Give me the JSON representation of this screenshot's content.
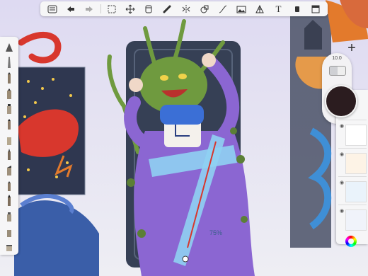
{
  "toolbar": {
    "icons": [
      "menu-icon",
      "undo-icon",
      "redo-icon",
      "selection-icon",
      "transform-icon",
      "layer-icon",
      "eraser-icon",
      "symmetry-icon",
      "shape-icon",
      "curve-icon",
      "image-icon",
      "perspective-icon",
      "text-icon",
      "fill-icon",
      "fullscreen-icon"
    ],
    "text_tool": "T"
  },
  "brush_panel": {
    "brushes": [
      "pencil",
      "pen",
      "marker",
      "airbrush",
      "brush",
      "smudge",
      "ink",
      "chisel",
      "crayon",
      "highlighter",
      "paint",
      "blender",
      "fill",
      "eraser"
    ]
  },
  "right_panel": {
    "add_label": "+",
    "brush_size": "10.0",
    "color": "#2b1c1f"
  },
  "canvas": {
    "cap_text": "+",
    "ruler_text": "75%",
    "ruler_sub": "75%"
  },
  "colors": {
    "background": "#e8e6ee",
    "robe": "#8b66d2",
    "creature": "#6f9a3f",
    "frame": "#3c4659",
    "red_dragon": "#d8372d",
    "blue_wave": "#3f8fd6",
    "orange_figure": "#e59a4a"
  }
}
